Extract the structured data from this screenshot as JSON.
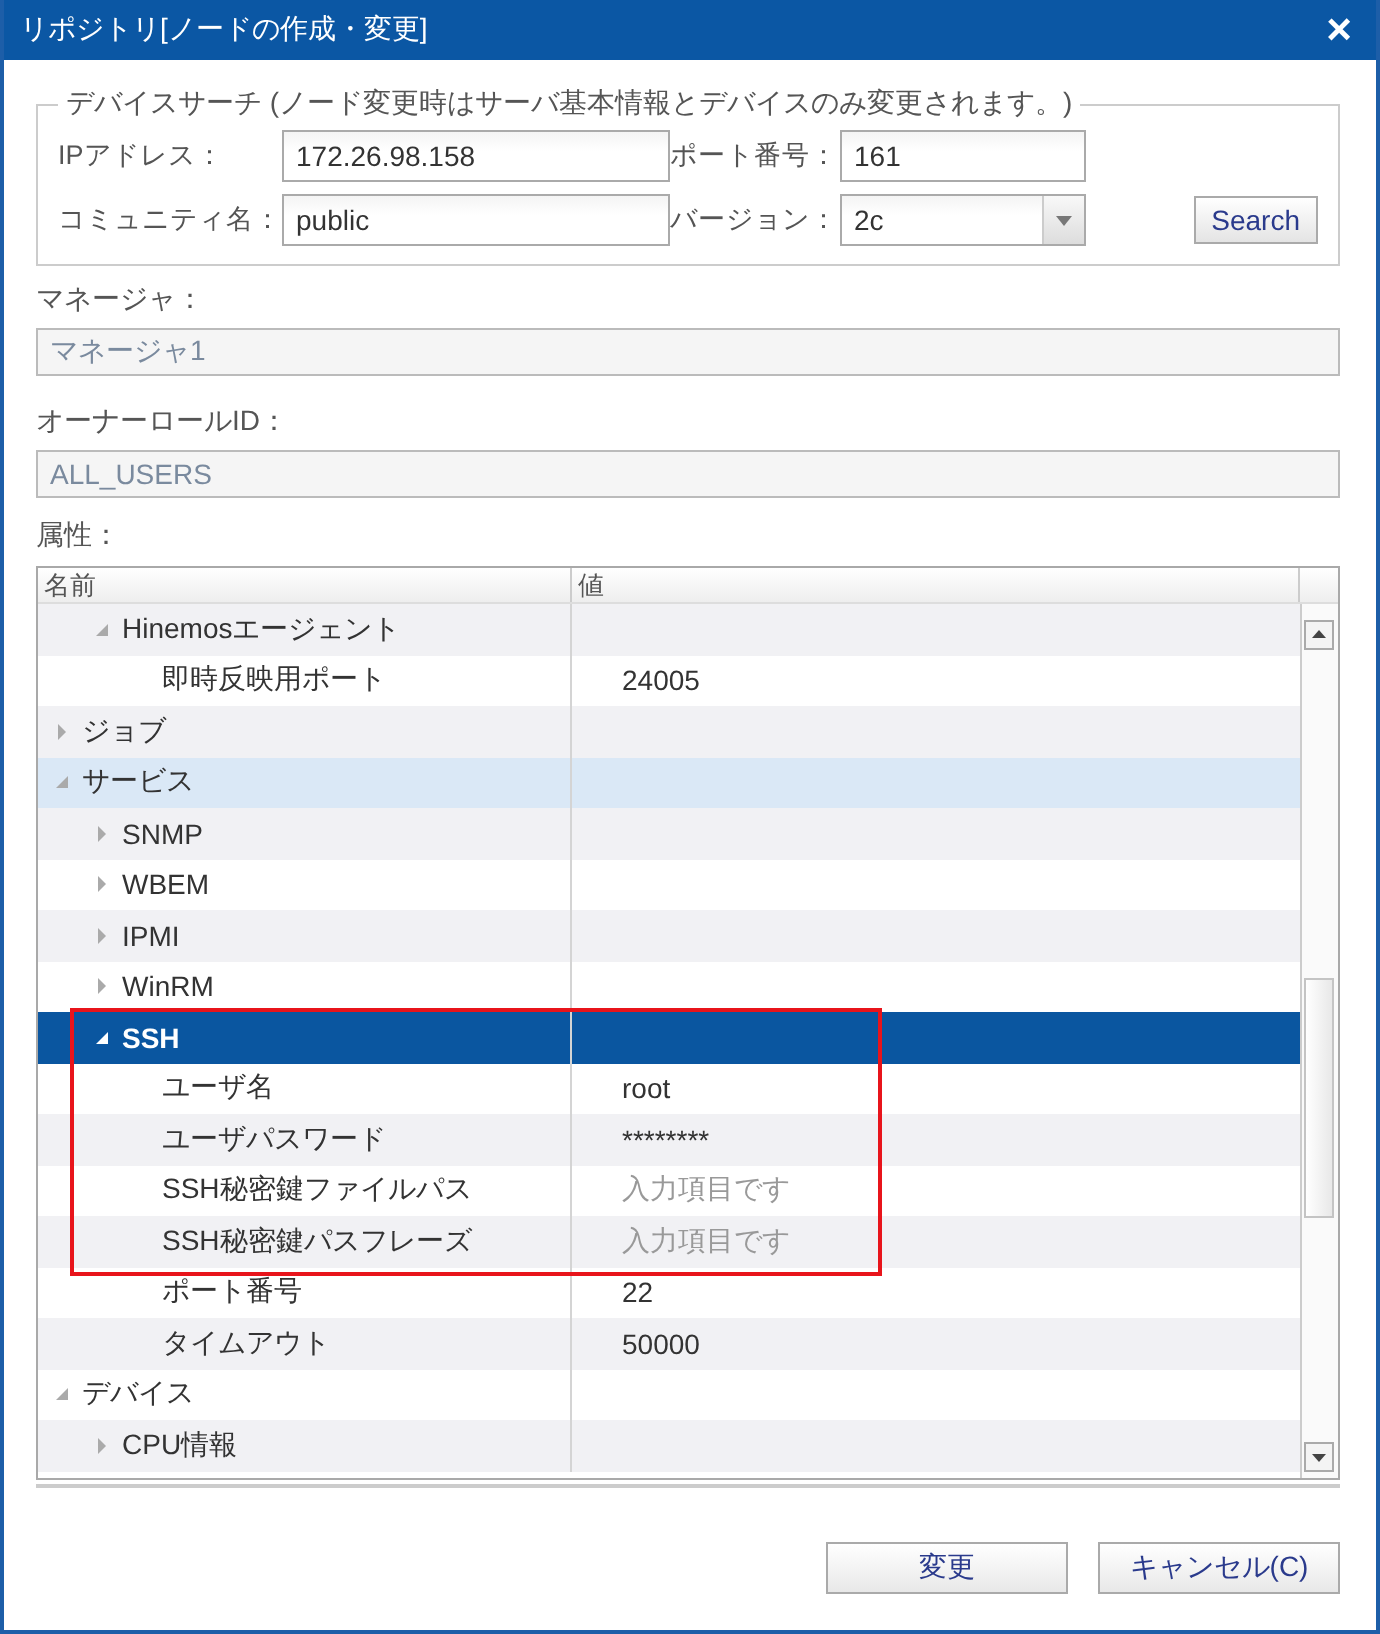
{
  "window": {
    "title": "リポジトリ[ノードの作成・変更]",
    "close": "×"
  },
  "device_search": {
    "legend": "デバイスサーチ (ノード変更時はサーバ基本情報とデバイスのみ変更されます。)",
    "fields": [
      {
        "label": "IPアドレス：",
        "value": "172.26.98.158",
        "kind": "text"
      },
      {
        "label": "ポート番号：",
        "value": "161",
        "kind": "text"
      },
      {
        "label": "コミュニティ名：",
        "value": "public",
        "kind": "text"
      },
      {
        "label": "バージョン：",
        "value": "2c",
        "kind": "select"
      }
    ],
    "search_button": "Search"
  },
  "manager": {
    "label": "マネージャ：",
    "value": "マネージャ1",
    "disabled": true
  },
  "owner_role": {
    "label": "オーナーロールID：",
    "value": "ALL_USERS",
    "disabled": true
  },
  "attributes": {
    "label": "属性：",
    "columns": [
      "名前",
      "値"
    ],
    "scrolled_parent": {
      "children": [
        {
          "name": "Hinemosエージェント",
          "expanded": true,
          "selected": false,
          "children": [
            {
              "name": "即時反映用ポート",
              "value": "24005",
              "selected": false
            }
          ]
        }
      ]
    },
    "items": [
      {
        "name": "ジョブ",
        "expanded": false,
        "selected": false
      },
      {
        "name": "サービス",
        "expanded": true,
        "selected": false,
        "hovered": true,
        "children": [
          {
            "name": "SNMP",
            "expanded": false,
            "selected": false
          },
          {
            "name": "WBEM",
            "expanded": false,
            "selected": false
          },
          {
            "name": "IPMI",
            "expanded": false,
            "selected": false
          },
          {
            "name": "WinRM",
            "expanded": false,
            "selected": false
          },
          {
            "name": "SSH",
            "expanded": true,
            "selected": true,
            "children": [
              {
                "name": "ユーザ名",
                "value": "root",
                "selected": false,
                "highlighted": true
              },
              {
                "name": "ユーザパスワード",
                "value": "********",
                "selected": false,
                "highlighted": true
              },
              {
                "name": "SSH秘密鍵ファイルパス",
                "placeholder": "入力項目です",
                "selected": false,
                "highlighted": true
              },
              {
                "name": "SSH秘密鍵パスフレーズ",
                "placeholder": "入力項目です",
                "selected": false,
                "highlighted": true
              },
              {
                "name": "ポート番号",
                "value": "22",
                "selected": false
              },
              {
                "name": "タイムアウト",
                "value": "50000",
                "selected": false
              }
            ]
          }
        ]
      },
      {
        "name": "デバイス",
        "expanded": true,
        "selected": false,
        "children": [
          {
            "name": "CPU情報",
            "expanded": false,
            "selected": false
          }
        ]
      }
    ]
  },
  "buttons": [
    "変更",
    "キャンセル(C)"
  ]
}
